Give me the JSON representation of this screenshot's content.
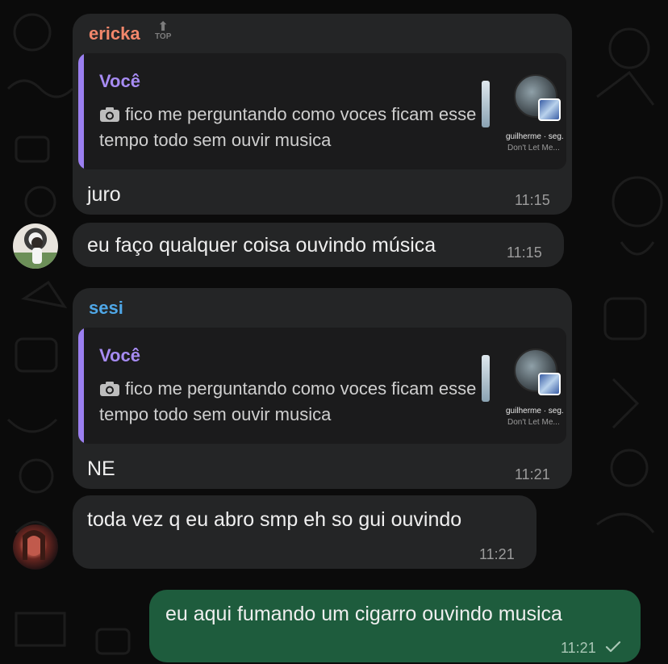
{
  "colors": {
    "background": "#0b0b0b",
    "incoming_bubble": "#242526",
    "outgoing_bubble": "#1e5c3d",
    "quote_bar": "#9b7ff0",
    "sender_ericka": "#f2876b",
    "sender_sesi": "#4fa8e8"
  },
  "messages": [
    {
      "sender": "ericka",
      "top_badge": "TOP",
      "quote": {
        "author": "Você",
        "icon": "camera-icon",
        "text": "fico me perguntando como voces ficam esse tempo todo sem ouvir musica",
        "thumb_caption_1": "guilherme · seg.",
        "thumb_caption_2": "Don't Let Me..."
      },
      "text": "juro",
      "time": "11:15"
    },
    {
      "text": "eu faço qualquer coisa ouvindo música",
      "time": "11:15"
    },
    {
      "sender": "sesi",
      "quote": {
        "author": "Você",
        "icon": "camera-icon",
        "text": "fico me perguntando como voces ficam esse tempo todo sem ouvir musica",
        "thumb_caption_1": "guilherme · seg.",
        "thumb_caption_2": "Don't Let Me..."
      },
      "text": "NE",
      "time": "11:21"
    },
    {
      "text": "toda vez q eu abro smp eh so gui ouvindo",
      "time": "11:21"
    },
    {
      "text": "eu aqui fumando um cigarro ouvindo musica",
      "time": "11:21",
      "status_icon": "checkmark-icon"
    }
  ]
}
